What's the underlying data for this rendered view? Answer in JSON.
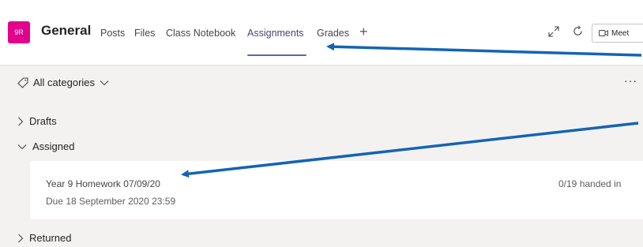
{
  "header": {
    "team_initials": "9R",
    "channel": "General",
    "tabs": [
      {
        "label": "Posts"
      },
      {
        "label": "Files"
      },
      {
        "label": "Class Notebook"
      },
      {
        "label": "Assignments",
        "active": true
      },
      {
        "label": "Grades"
      }
    ],
    "meet_label": "Meet"
  },
  "filter": {
    "label": "All categories"
  },
  "sections": {
    "drafts": "Drafts",
    "assigned": "Assigned",
    "returned": "Returned"
  },
  "assignment": {
    "title": "Year 9 Homework 07/09/20",
    "due": "Due 18 September 2020 23:59",
    "status": "0/19 handed in"
  },
  "colors": {
    "badge": "#e3008c",
    "accent": "#6264a7",
    "annotation_arrow": "#1464b4"
  },
  "icons": [
    "tag-icon",
    "chevron-down-icon",
    "chevron-right-icon",
    "expand-icon",
    "refresh-icon",
    "video-camera-icon",
    "plus-icon",
    "more-icon"
  ]
}
